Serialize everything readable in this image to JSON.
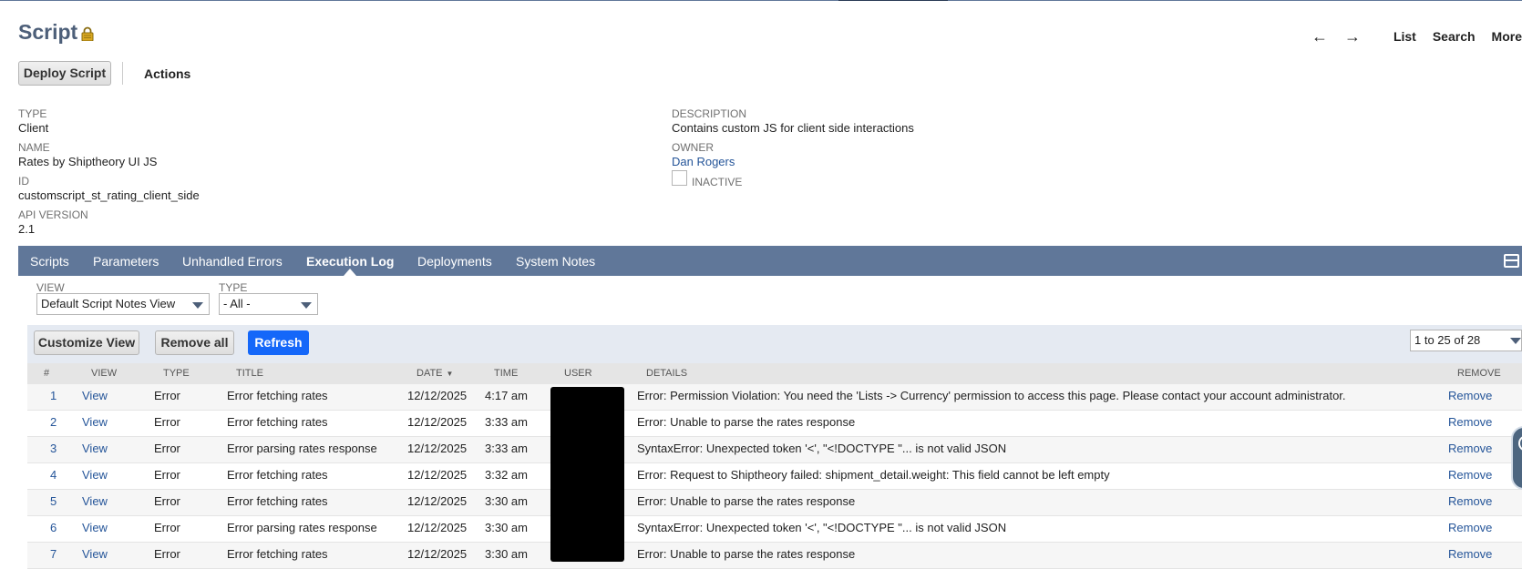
{
  "page": {
    "title": "Script"
  },
  "nav": {
    "back": "←",
    "forward": "→",
    "list": "List",
    "search": "Search",
    "more": "More"
  },
  "actions": {
    "deploy": "Deploy Script",
    "actions": "Actions"
  },
  "fields": {
    "type_label": "TYPE",
    "type_value": "Client",
    "name_label": "NAME",
    "name_value": "Rates by Shiptheory UI JS",
    "id_label": "ID",
    "id_value": "customscript_st_rating_client_side",
    "api_label": "API VERSION",
    "api_value": "2.1",
    "desc_label": "DESCRIPTION",
    "desc_value": "Contains custom JS for client side interactions",
    "owner_label": "OWNER",
    "owner_value": "Dan Rogers",
    "inactive_label": "INACTIVE"
  },
  "tabs": [
    {
      "label": "Scripts"
    },
    {
      "label": "Parameters"
    },
    {
      "label": "Unhandled Errors"
    },
    {
      "label": "Execution Log"
    },
    {
      "label": "Deployments"
    },
    {
      "label": "System Notes"
    }
  ],
  "filters": {
    "view_label": "VIEW",
    "view_value": "Default Script Notes View",
    "type_label": "TYPE",
    "type_value": "- All -"
  },
  "toolbar": {
    "customize": "Customize View",
    "remove_all": "Remove all",
    "refresh": "Refresh",
    "pager": "1 to 25 of 28"
  },
  "table": {
    "headers": {
      "num": "#",
      "view": "VIEW",
      "type": "TYPE",
      "title": "TITLE",
      "date": "DATE",
      "time": "TIME",
      "user": "USER",
      "details": "DETAILS",
      "remove": "REMOVE"
    },
    "sort_icon": "▼",
    "rows": [
      {
        "num": "1",
        "view": "View",
        "type": "Error",
        "title": "Error fetching rates",
        "date": "12/12/2025",
        "time": "4:17 am",
        "details": "Error: Permission Violation: You need the 'Lists -> Currency' permission to access this page. Please contact your account administrator.",
        "remove": "Remove"
      },
      {
        "num": "2",
        "view": "View",
        "type": "Error",
        "title": "Error fetching rates",
        "date": "12/12/2025",
        "time": "3:33 am",
        "details": "Error: Unable to parse the rates response",
        "remove": "Remove"
      },
      {
        "num": "3",
        "view": "View",
        "type": "Error",
        "title": "Error parsing rates response",
        "date": "12/12/2025",
        "time": "3:33 am",
        "details": "SyntaxError: Unexpected token '<', \"<!DOCTYPE \"... is not valid JSON",
        "remove": "Remove"
      },
      {
        "num": "4",
        "view": "View",
        "type": "Error",
        "title": "Error fetching rates",
        "date": "12/12/2025",
        "time": "3:32 am",
        "details": "Error: Request to Shiptheory failed: shipment_detail.weight: This field cannot be left empty",
        "remove": "Remove"
      },
      {
        "num": "5",
        "view": "View",
        "type": "Error",
        "title": "Error fetching rates",
        "date": "12/12/2025",
        "time": "3:30 am",
        "details": "Error: Unable to parse the rates response",
        "remove": "Remove"
      },
      {
        "num": "6",
        "view": "View",
        "type": "Error",
        "title": "Error parsing rates response",
        "date": "12/12/2025",
        "time": "3:30 am",
        "details": "SyntaxError: Unexpected token '<', \"<!DOCTYPE \"... is not valid JSON",
        "remove": "Remove"
      },
      {
        "num": "7",
        "view": "View",
        "type": "Error",
        "title": "Error fetching rates",
        "date": "12/12/2025",
        "time": "3:30 am",
        "details": "Error: Unable to parse the rates response",
        "remove": "Remove"
      }
    ]
  }
}
